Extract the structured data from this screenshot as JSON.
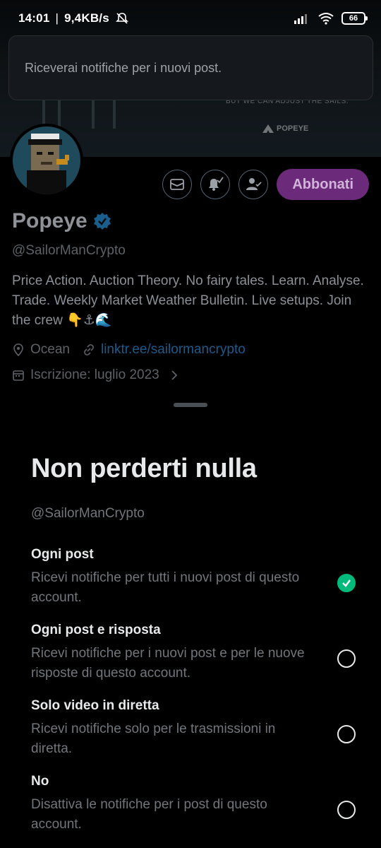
{
  "status_bar": {
    "time": "14:01",
    "network_speed": "9,4KB/s",
    "battery": "66"
  },
  "banner": {
    "tagline": "BUT WE CAN ADJUST THE SAILS.",
    "brand": "POPEYE"
  },
  "toast": {
    "message": "Riceverai notifiche per i nuovi post."
  },
  "actions": {
    "subscribe_label": "Abbonati"
  },
  "profile": {
    "name": "Popeye",
    "handle": "@SailorManCrypto",
    "bio": "Price Action. Auction Theory. No fairy tales. Learn. Analyse. Trade. Weekly Market Weather Bulletin. Live setups. Join the crew 👇⚓🌊",
    "location": "Ocean",
    "link": "linktr.ee/sailormancrypto",
    "joined": "Iscrizione: luglio 2023"
  },
  "sheet": {
    "title": "Non perderti nulla",
    "subtitle": "@SailorManCrypto",
    "options": [
      {
        "title": "Ogni post",
        "desc": "Ricevi notifiche per tutti i nuovi post di questo account.",
        "checked": true
      },
      {
        "title": "Ogni post e risposta",
        "desc": "Ricevi notifiche per i nuovi post e per le nuove risposte di questo account.",
        "checked": false
      },
      {
        "title": "Solo video in diretta",
        "desc": "Ricevi notifiche solo per le trasmissioni in diretta.",
        "checked": false
      },
      {
        "title": "No",
        "desc": "Disattiva le notifiche per i post di questo account.",
        "checked": false
      }
    ]
  },
  "colors": {
    "accent_green": "#00ba7c",
    "subscribe_bg": "#6b2a7a",
    "link": "#1d9bf0"
  }
}
